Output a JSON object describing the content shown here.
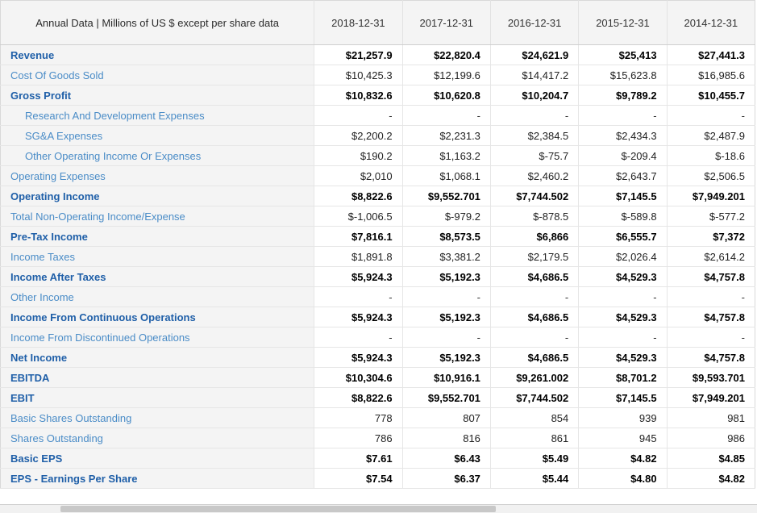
{
  "table": {
    "label_header": "Annual Data | Millions of US $ except per share data",
    "year_columns": [
      "2018-12-31",
      "2017-12-31",
      "2016-12-31",
      "2015-12-31",
      "2014-12-31"
    ],
    "rows": [
      {
        "label": "Revenue",
        "bold": true,
        "indent": false,
        "values": [
          "$21,257.9",
          "$22,820.4",
          "$24,621.9",
          "$25,413",
          "$27,441.3"
        ]
      },
      {
        "label": "Cost Of Goods Sold",
        "bold": false,
        "indent": false,
        "values": [
          "$10,425.3",
          "$12,199.6",
          "$14,417.2",
          "$15,623.8",
          "$16,985.6"
        ]
      },
      {
        "label": "Gross Profit",
        "bold": true,
        "indent": false,
        "values": [
          "$10,832.6",
          "$10,620.8",
          "$10,204.7",
          "$9,789.2",
          "$10,455.7"
        ]
      },
      {
        "label": "Research And Development Expenses",
        "bold": false,
        "indent": true,
        "values": [
          "-",
          "-",
          "-",
          "-",
          "-"
        ]
      },
      {
        "label": "SG&A Expenses",
        "bold": false,
        "indent": true,
        "values": [
          "$2,200.2",
          "$2,231.3",
          "$2,384.5",
          "$2,434.3",
          "$2,487.9"
        ]
      },
      {
        "label": "Other Operating Income Or Expenses",
        "bold": false,
        "indent": true,
        "values": [
          "$190.2",
          "$1,163.2",
          "$-75.7",
          "$-209.4",
          "$-18.6"
        ]
      },
      {
        "label": "Operating Expenses",
        "bold": false,
        "indent": false,
        "values": [
          "$2,010",
          "$1,068.1",
          "$2,460.2",
          "$2,643.7",
          "$2,506.5"
        ]
      },
      {
        "label": "Operating Income",
        "bold": true,
        "indent": false,
        "values": [
          "$8,822.6",
          "$9,552.701",
          "$7,744.502",
          "$7,145.5",
          "$7,949.201"
        ]
      },
      {
        "label": "Total Non-Operating Income/Expense",
        "bold": false,
        "indent": false,
        "values": [
          "$-1,006.5",
          "$-979.2",
          "$-878.5",
          "$-589.8",
          "$-577.2"
        ]
      },
      {
        "label": "Pre-Tax Income",
        "bold": true,
        "indent": false,
        "values": [
          "$7,816.1",
          "$8,573.5",
          "$6,866",
          "$6,555.7",
          "$7,372"
        ]
      },
      {
        "label": "Income Taxes",
        "bold": false,
        "indent": false,
        "values": [
          "$1,891.8",
          "$3,381.2",
          "$2,179.5",
          "$2,026.4",
          "$2,614.2"
        ]
      },
      {
        "label": "Income After Taxes",
        "bold": true,
        "indent": false,
        "values": [
          "$5,924.3",
          "$5,192.3",
          "$4,686.5",
          "$4,529.3",
          "$4,757.8"
        ]
      },
      {
        "label": "Other Income",
        "bold": false,
        "indent": false,
        "values": [
          "-",
          "-",
          "-",
          "-",
          "-"
        ]
      },
      {
        "label": "Income From Continuous Operations",
        "bold": true,
        "indent": false,
        "values": [
          "$5,924.3",
          "$5,192.3",
          "$4,686.5",
          "$4,529.3",
          "$4,757.8"
        ]
      },
      {
        "label": "Income From Discontinued Operations",
        "bold": false,
        "indent": false,
        "values": [
          "-",
          "-",
          "-",
          "-",
          "-"
        ]
      },
      {
        "label": "Net Income",
        "bold": true,
        "indent": false,
        "values": [
          "$5,924.3",
          "$5,192.3",
          "$4,686.5",
          "$4,529.3",
          "$4,757.8"
        ]
      },
      {
        "label": "EBITDA",
        "bold": true,
        "indent": false,
        "values": [
          "$10,304.6",
          "$10,916.1",
          "$9,261.002",
          "$8,701.2",
          "$9,593.701"
        ]
      },
      {
        "label": "EBIT",
        "bold": true,
        "indent": false,
        "values": [
          "$8,822.6",
          "$9,552.701",
          "$7,744.502",
          "$7,145.5",
          "$7,949.201"
        ]
      },
      {
        "label": "Basic Shares Outstanding",
        "bold": false,
        "indent": false,
        "values": [
          "778",
          "807",
          "854",
          "939",
          "981"
        ]
      },
      {
        "label": "Shares Outstanding",
        "bold": false,
        "indent": false,
        "values": [
          "786",
          "816",
          "861",
          "945",
          "986"
        ]
      },
      {
        "label": "Basic EPS",
        "bold": true,
        "indent": false,
        "values": [
          "$7.61",
          "$6.43",
          "$5.49",
          "$4.82",
          "$4.85"
        ]
      },
      {
        "label": "EPS - Earnings Per Share",
        "bold": true,
        "indent": false,
        "values": [
          "$7.54",
          "$6.37",
          "$5.44",
          "$4.80",
          "$4.82"
        ]
      }
    ]
  },
  "scrollbar": {
    "orientation": "horizontal"
  },
  "colors": {
    "label_bold": "#1f5fa8",
    "label_regular": "#4a8cc7",
    "header_background": "#f4f4f4",
    "value_background": "#ffffff",
    "grid_line": "#e6e6e6"
  }
}
